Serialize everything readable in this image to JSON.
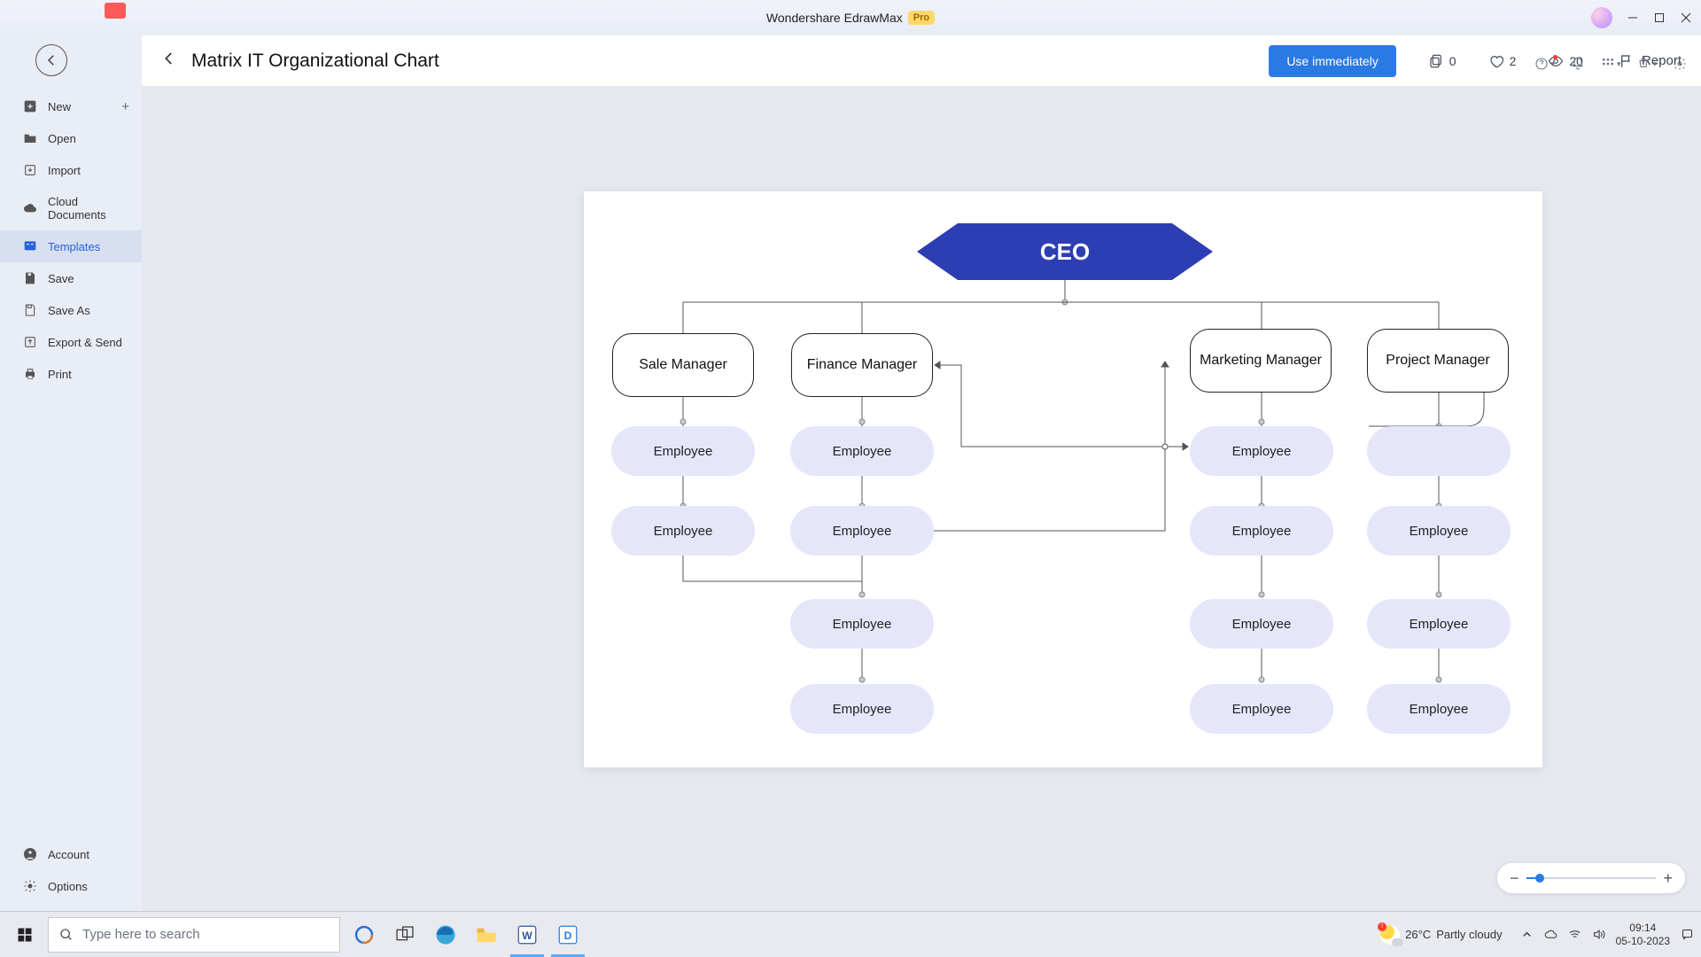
{
  "title_bar": {
    "app_name": "Wondershare EdrawMax",
    "pro": "Pro"
  },
  "sidebar": {
    "items": [
      {
        "label": "New"
      },
      {
        "label": "Open"
      },
      {
        "label": "Import"
      },
      {
        "label": "Cloud Documents"
      },
      {
        "label": "Templates"
      },
      {
        "label": "Save"
      },
      {
        "label": "Save As"
      },
      {
        "label": "Export & Send"
      },
      {
        "label": "Print"
      }
    ],
    "bottom": [
      {
        "label": "Account"
      },
      {
        "label": "Options"
      }
    ]
  },
  "main_header": {
    "title": "Matrix IT Organizational Chart",
    "use_button": "Use immediately",
    "copies": "0",
    "likes": "2",
    "views": "20",
    "report": "Report"
  },
  "chart": {
    "ceo": "CEO",
    "managers": [
      "Sale Manager",
      "Finance Manager",
      "Marketing Manager",
      "Project Manager"
    ],
    "emp_label": "Employee"
  },
  "taskbar": {
    "search_placeholder": "Type here to search",
    "weather_temp": "26°C",
    "weather_text": "Partly cloudy",
    "time": "09:14",
    "date": "05-10-2023"
  },
  "chart_data": {
    "type": "diagram",
    "title": "Matrix IT Organizational Chart",
    "root": "CEO",
    "branches": [
      {
        "manager": "Sale Manager",
        "employees": [
          "Employee",
          "Employee"
        ]
      },
      {
        "manager": "Finance Manager",
        "employees": [
          "Employee",
          "Employee",
          "Employee",
          "Employee"
        ]
      },
      {
        "manager": "Marketing Manager",
        "employees": [
          "Employee",
          "Employee",
          "Employee",
          "Employee"
        ]
      },
      {
        "manager": "Project Manager",
        "employees": [
          "",
          "Employee",
          "Employee",
          "Employee"
        ]
      }
    ],
    "matrix_links": [
      {
        "from": "Finance Manager",
        "to": "Marketing Manager"
      },
      {
        "from": "Finance Manager.Employee2",
        "to": "Marketing Manager.Employee1"
      },
      {
        "from": "Sale Manager.Employee2",
        "to": "Finance Manager.Employee3"
      }
    ]
  }
}
